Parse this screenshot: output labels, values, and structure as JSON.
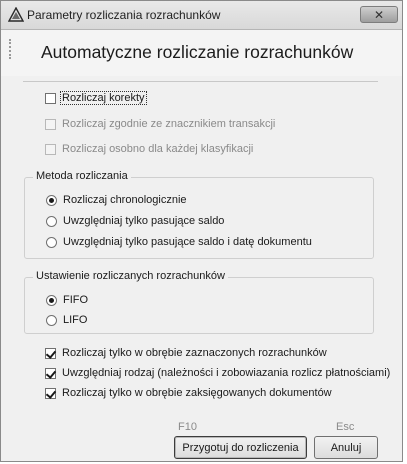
{
  "window": {
    "title": "Parametry rozliczania rozrachunków",
    "close_symbol": "✕"
  },
  "header": {
    "title": "Automatyczne rozliczanie rozrachunków"
  },
  "options": {
    "korekty": {
      "label": "Rozliczaj korekty",
      "checked": false,
      "enabled": true
    },
    "znacznik": {
      "label": "Rozliczaj zgodnie ze znacznikiem transakcji",
      "checked": false,
      "enabled": false
    },
    "klasyfikacja": {
      "label": "Rozliczaj osobno dla każdej klasyfikacji",
      "checked": false,
      "enabled": false
    }
  },
  "metoda": {
    "legend": "Metoda rozliczania",
    "options": [
      {
        "label": "Rozliczaj chronologicznie",
        "checked": true
      },
      {
        "label": "Uwzględniaj tylko pasujące saldo",
        "checked": false
      },
      {
        "label": "Uwzględniaj tylko pasujące saldo i datę dokumentu",
        "checked": false
      }
    ]
  },
  "ustawienie": {
    "legend": "Ustawienie rozliczanych rozrachunków",
    "options": [
      {
        "label": "FIFO",
        "checked": true
      },
      {
        "label": "LIFO",
        "checked": false
      }
    ]
  },
  "bottom_options": [
    {
      "label": "Rozliczaj tylko w obrębie zaznaczonych rozrachunków",
      "checked": true
    },
    {
      "label": "Uwzględniaj rodzaj (należności i zobowiazania rozlicz płatnościami)",
      "checked": true
    },
    {
      "label": "Rozliczaj tylko w obrębie zaksięgowanych dokumentów",
      "checked": true
    }
  ],
  "buttons": {
    "prepare": {
      "label": "Przygotuj do rozliczenia",
      "shortcut": "F10"
    },
    "cancel": {
      "label": "Anuluj",
      "shortcut": "Esc"
    }
  }
}
